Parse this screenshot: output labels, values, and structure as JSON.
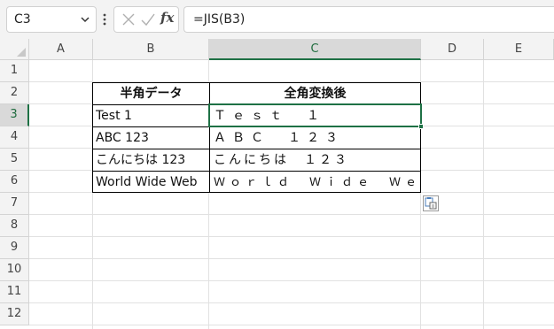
{
  "formula_bar": {
    "name_box": "C3",
    "formula": "=JIS(B3)",
    "fx_label": "fx"
  },
  "columns": [
    "A",
    "B",
    "C",
    "D",
    "E"
  ],
  "rows": [
    "1",
    "2",
    "3",
    "4",
    "5",
    "6",
    "7",
    "8",
    "9",
    "10",
    "11",
    "12"
  ],
  "selected": {
    "column": "C",
    "row": "3"
  },
  "table": {
    "headers": [
      "半角データ",
      "全角変換後"
    ],
    "rows": [
      [
        "Test 1",
        "Ｔｅｓｔ　１"
      ],
      [
        "ABC 123",
        "ＡＢＣ　１２３"
      ],
      [
        "こんにちは 123",
        "こんにちは　１２３"
      ],
      [
        "World Wide Web",
        "Ｗｏｒｌｄ　Ｗｉｄｅ　Ｗｅｂ"
      ]
    ]
  },
  "colors": {
    "selection": "#1e7145",
    "header_bg": "#f3f3f3",
    "gridline": "#e1e1e1"
  },
  "icons": [
    "chevron-down-icon",
    "more-icon",
    "cancel-icon",
    "enter-icon",
    "fx-icon",
    "paste-options-icon"
  ]
}
